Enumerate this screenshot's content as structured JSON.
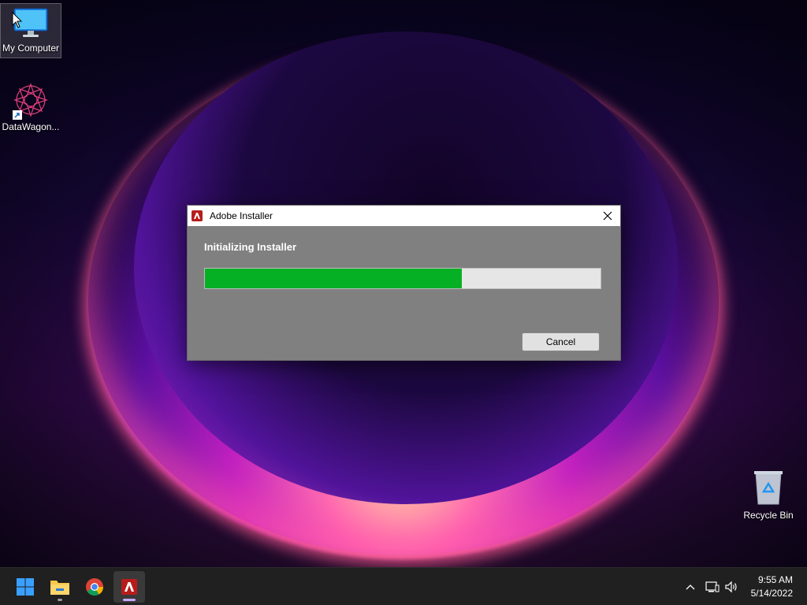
{
  "desktop": {
    "icons": [
      {
        "label": "My Computer"
      },
      {
        "label": "DataWagon..."
      },
      {
        "label": "Recycle Bin"
      }
    ]
  },
  "dialog": {
    "title": "Adobe Installer",
    "heading": "Initializing Installer",
    "progress_percent": 65,
    "cancel_label": "Cancel"
  },
  "taskbar": {
    "apps": [
      "start-icon",
      "file-explorer-icon",
      "chrome-icon",
      "adobe-installer-icon"
    ],
    "active_app": "adobe-installer-icon"
  },
  "tray": {
    "time": "9:55 AM",
    "date": "5/14/2022"
  },
  "colors": {
    "progress_fill": "#06b025",
    "dialog_bg": "#808080",
    "taskbar_bg": "#202020"
  }
}
